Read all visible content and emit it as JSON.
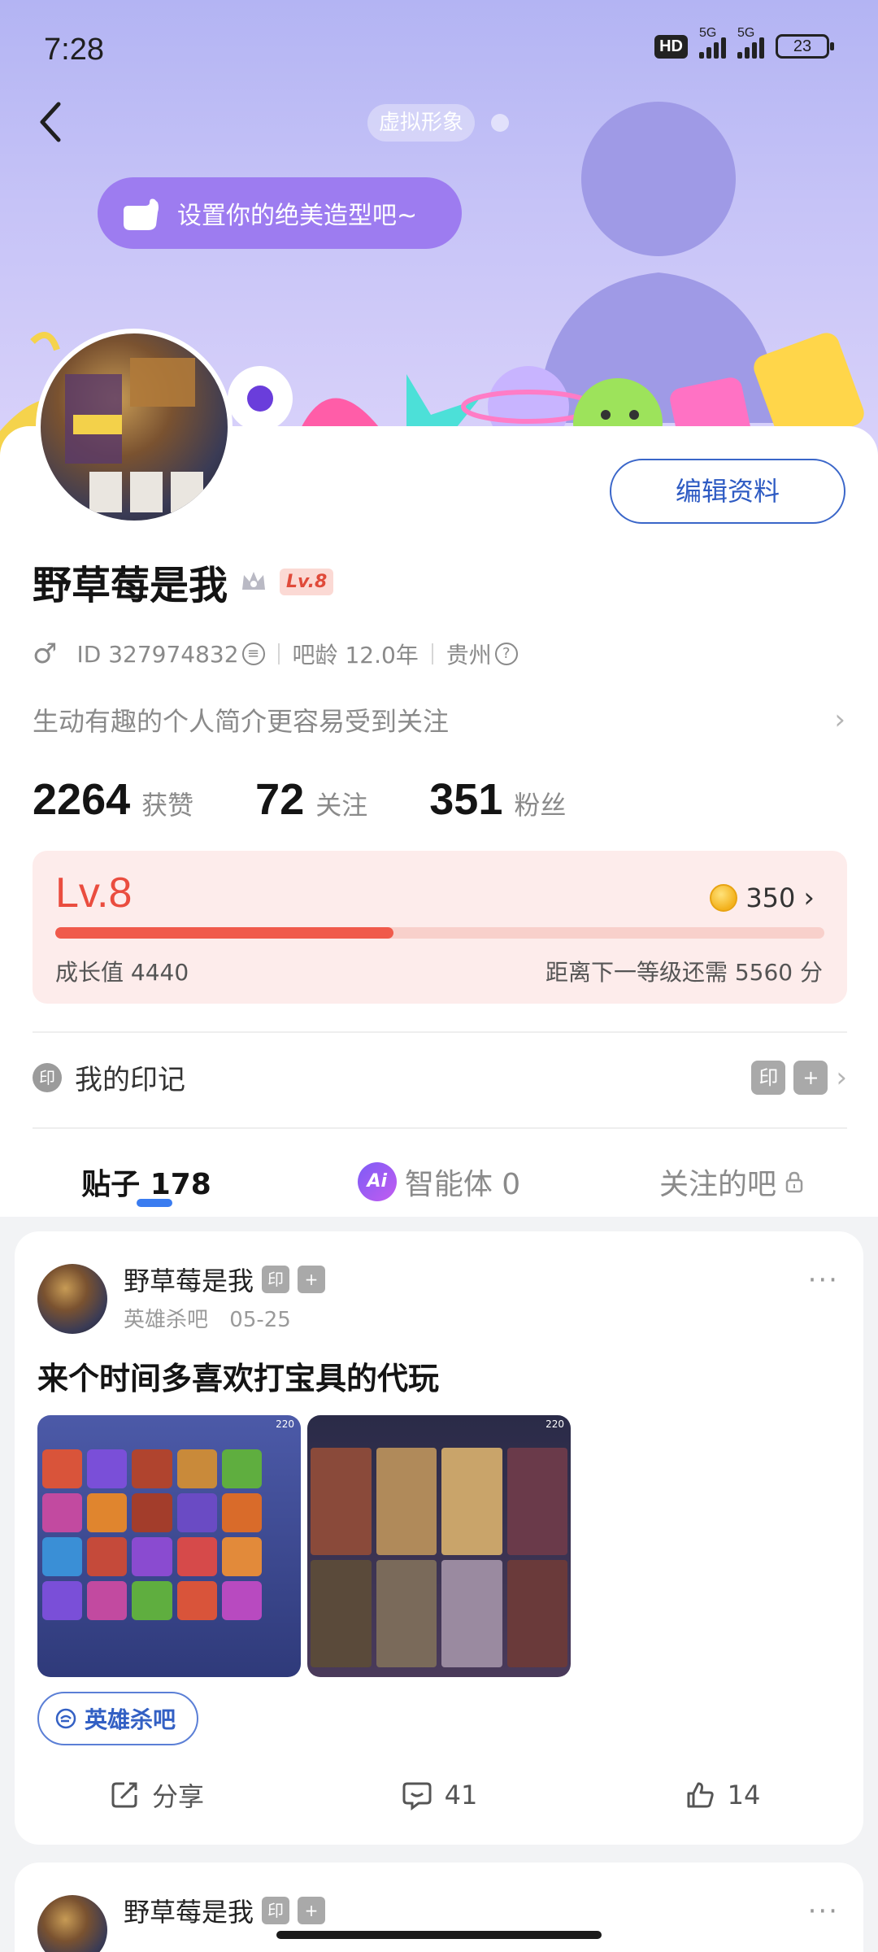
{
  "status_bar": {
    "time": "7:28",
    "hd": "HD",
    "net1": "5G",
    "net2": "5G",
    "battery": "23"
  },
  "banner": {
    "avatar_chip": "虚拟形象",
    "setup_text": "设置你的绝美造型吧~"
  },
  "profile": {
    "edit_button": "编辑资料",
    "name": "野草莓是我",
    "level_badge": "Lv.8",
    "gender": "♂",
    "id_text": "ID 327974832",
    "age_text": "吧龄 12.0年",
    "location": "贵州",
    "bio_placeholder": "生动有趣的个人简介更容易受到关注"
  },
  "stats": [
    {
      "value": "2264",
      "label": "获赞"
    },
    {
      "value": "72",
      "label": "关注"
    },
    {
      "value": "351",
      "label": "粉丝"
    }
  ],
  "level_card": {
    "level": "Lv.8",
    "coins": "350",
    "progress": 0.44,
    "growth_text": "成长值 4440",
    "next_text": "距离下一等级还需 5560 分"
  },
  "seal": {
    "icon": "印",
    "title": "我的印记",
    "tag1": "印",
    "tag2": "+"
  },
  "tabs": [
    {
      "label": "贴子 178"
    },
    {
      "label": "智能体 0",
      "icon": "Ai"
    },
    {
      "label": "关注的吧"
    }
  ],
  "post": {
    "author": "野草莓是我",
    "tag1": "印",
    "tag2": "+",
    "forum": "英雄杀吧",
    "date": "05-25",
    "title": "来个时间多喜欢打宝具的代玩",
    "img_badge": "220",
    "forum_chip": "英雄杀吧",
    "share": "分享",
    "comments": "41",
    "likes": "14"
  },
  "post2": {
    "author": "野草莓是我",
    "tag1": "印",
    "tag2": "+"
  }
}
